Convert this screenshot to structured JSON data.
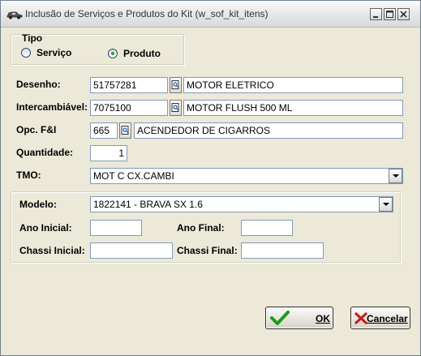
{
  "window": {
    "title": "Inclusão de Serviços e Produtos do Kit (w_sof_kit_itens)"
  },
  "tipo": {
    "label": "Tipo",
    "options": [
      "Serviço",
      "Produto"
    ],
    "selected": "Produto"
  },
  "form": {
    "desenho": {
      "label": "Desenho:",
      "code": "51757281",
      "description": "MOTOR ELETRICO"
    },
    "intercambiavel": {
      "label": "Intercambiável:",
      "code": "7075100",
      "description": "MOTOR FLUSH 500 ML"
    },
    "opc": {
      "label": "Opc. F&I",
      "code": "665",
      "description": "ACENDEDOR DE CIGARROS"
    },
    "quantidade": {
      "label": "Quantidade:",
      "value": "1"
    },
    "tmo": {
      "label": "TMO:",
      "value": "MOT C CX.CAMBI"
    }
  },
  "modelo_group": {
    "modelo": {
      "label": "Modelo:",
      "value": "1822141 - BRAVA SX 1.6"
    },
    "ano_inicial": {
      "label": "Ano Inicial:",
      "value": ""
    },
    "ano_final": {
      "label": "Ano Final:",
      "value": ""
    },
    "chassi_inicial": {
      "label": "Chassi Inicial:",
      "value": ""
    },
    "chassi_final": {
      "label": "Chassi Final:",
      "value": ""
    }
  },
  "buttons": {
    "ok": "OK",
    "cancel": "Cancelar"
  },
  "colors": {
    "ok_check": "#1e9a1e",
    "cancel_x": "#c81e1e",
    "radio_dot": "#21a121"
  },
  "icons": [
    "car-icon",
    "minimize-icon",
    "maximize-icon",
    "close-icon",
    "lookup-icon",
    "dropdown-arrow-icon",
    "checkmark-icon",
    "x-mark-icon"
  ]
}
